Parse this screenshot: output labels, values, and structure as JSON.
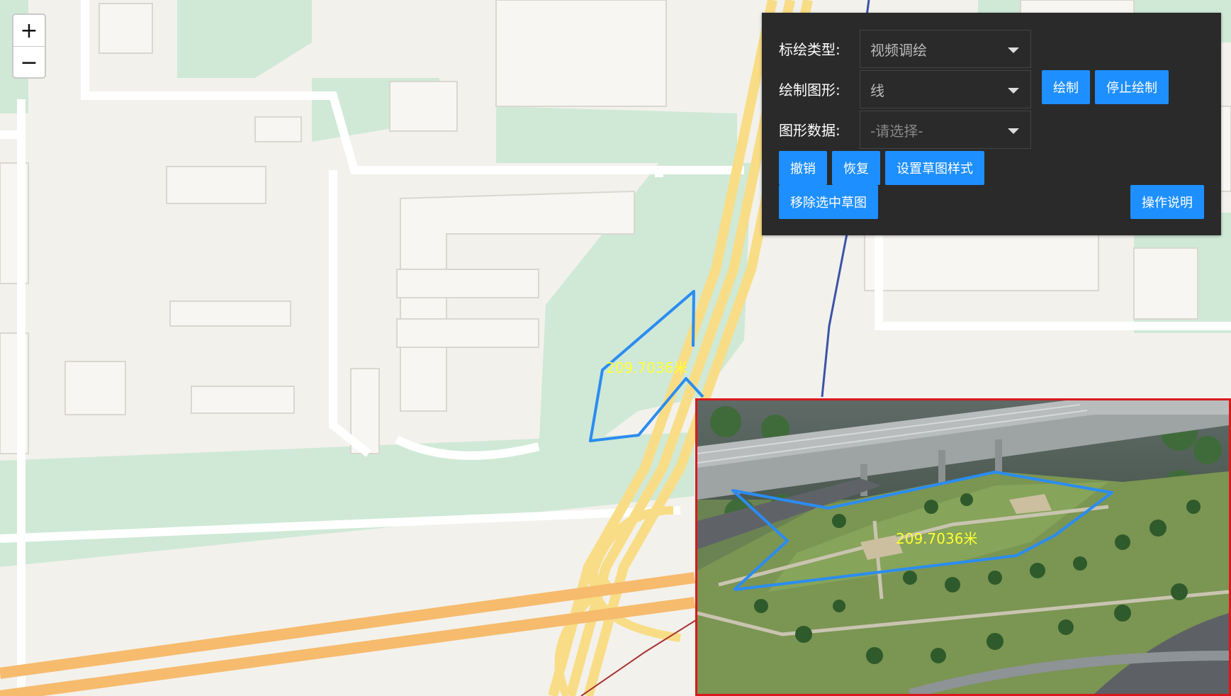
{
  "map": {
    "zoom_in": "+",
    "zoom_out": "−",
    "measure_label": "209.7036米",
    "line_color": "#2b8cf2"
  },
  "panel": {
    "type_label": "标绘类型:",
    "type_value": "视频调绘",
    "shape_label": "绘制图形:",
    "shape_value": "线",
    "data_label": "图形数据:",
    "data_placeholder": "-请选择-",
    "draw": "绘制",
    "stop_draw": "停止绘制",
    "undo": "撤销",
    "redo": "恢复",
    "set_style": "设置草图样式",
    "remove_selected": "移除选中草图",
    "help": "操作说明"
  },
  "video": {
    "measure_label": "209.7036米"
  },
  "colors": {
    "accent": "#1e8fff",
    "panel_bg": "#2a2a2a",
    "video_border": "#d9181d",
    "label_yellow": "#ffff33"
  }
}
